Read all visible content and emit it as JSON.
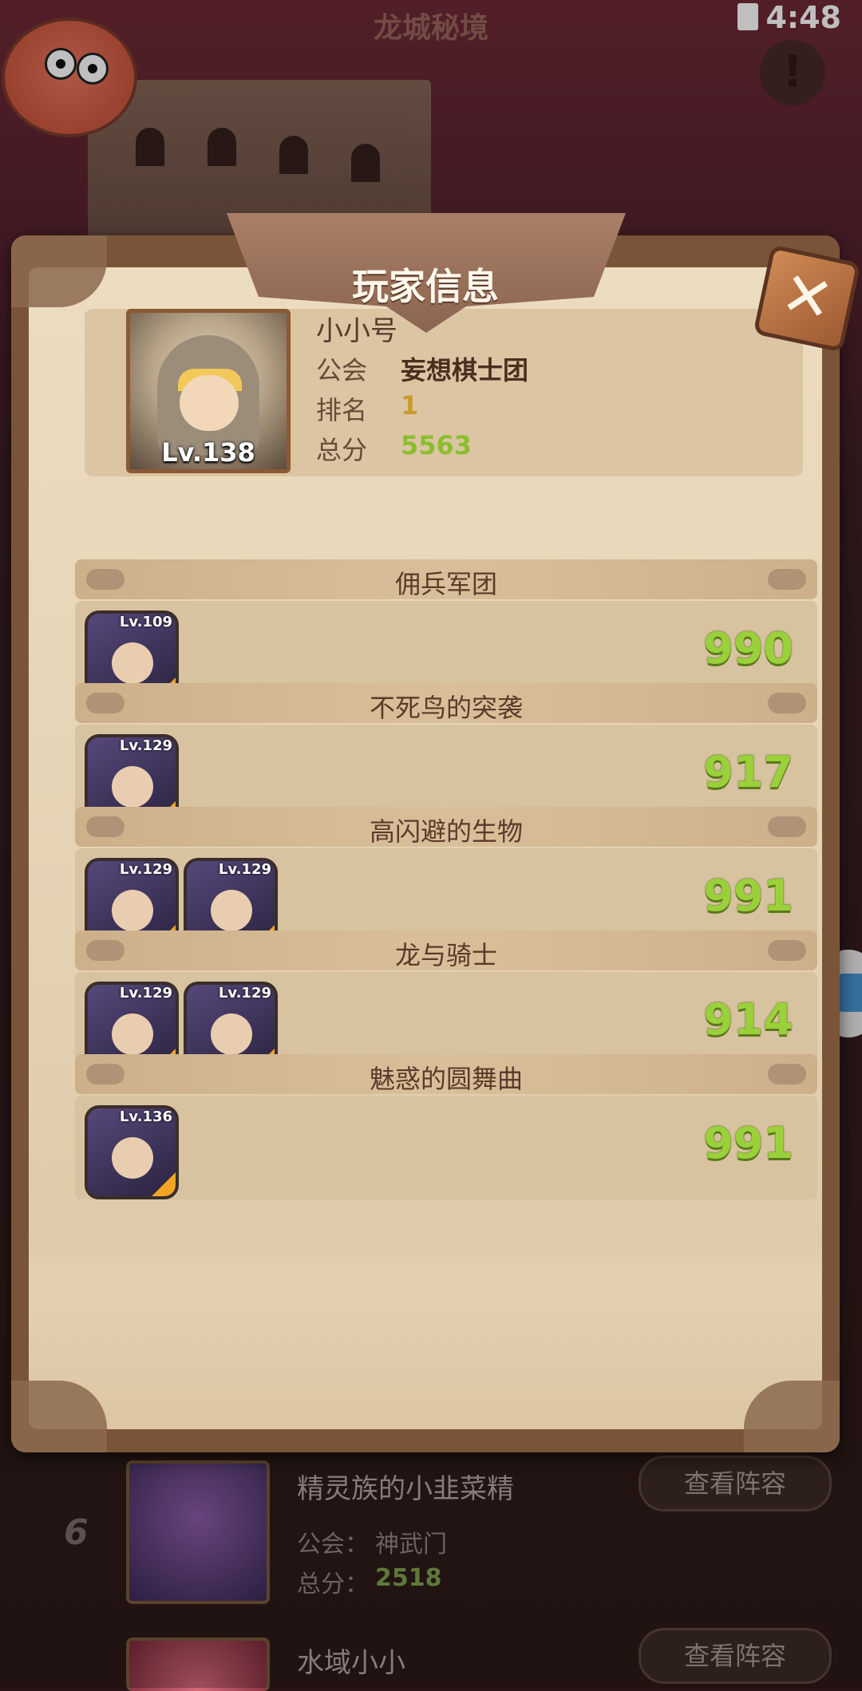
{
  "status_bar": {
    "time": "4:48"
  },
  "top_title": "龙城秘境",
  "background_list": [
    {
      "rank": "6",
      "name": "精灵族的小韭菜精",
      "guild_label": "公会：",
      "guild": "神武门",
      "score_label": "总分：",
      "score": "2518",
      "button": "查看阵容"
    },
    {
      "rank": "",
      "name": "水域小小",
      "button": "查看阵容"
    }
  ],
  "modal": {
    "title": "玩家信息",
    "player": {
      "level": "Lv.138",
      "name": "小小号",
      "guild_label": "公会",
      "guild": "妄想棋士团",
      "rank_label": "排名",
      "rank": "1",
      "total_label": "总分",
      "total": "5563"
    },
    "sections": [
      {
        "title": "佣兵军团",
        "heroes": [
          {
            "level": "Lv.109",
            "icon": "skeleton-hero"
          }
        ],
        "score": "990"
      },
      {
        "title": "不死鸟的突袭",
        "heroes": [
          {
            "level": "Lv.129",
            "icon": "purple-mage-hero"
          }
        ],
        "score": "917"
      },
      {
        "title": "高闪避的生物",
        "heroes": [
          {
            "level": "Lv.129",
            "icon": "white-hair-hero"
          },
          {
            "level": "Lv.129",
            "icon": "elf-hero"
          }
        ],
        "score": "991"
      },
      {
        "title": "龙与骑士",
        "heroes": [
          {
            "level": "Lv.129",
            "icon": "blonde-knight-hero"
          },
          {
            "level": "Lv.129",
            "icon": "brown-hair-hero"
          }
        ],
        "score": "914"
      },
      {
        "title": "魅惑的圆舞曲",
        "heroes": [
          {
            "level": "Lv.136",
            "icon": "old-sage-hero"
          }
        ],
        "score": "991"
      }
    ]
  },
  "colors": {
    "score": "#9ad13a",
    "rank": "#c89b2a",
    "total": "#8bbe2f",
    "paper": "#e4d1b2",
    "frame": "#7a5438"
  }
}
